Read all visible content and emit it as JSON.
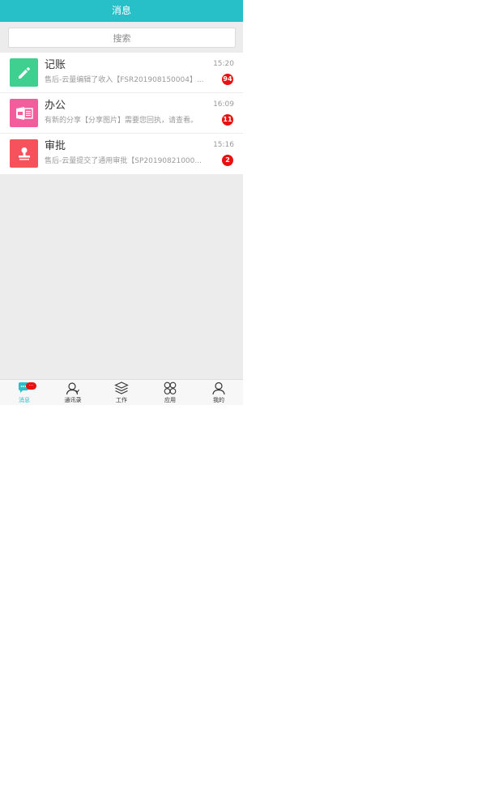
{
  "header": {
    "title": "消息"
  },
  "search": {
    "placeholder": "搜索"
  },
  "conversations": [
    {
      "title": "记账",
      "message": "售后-云量编辑了收入【FSR201908150004】...",
      "time": "15:20",
      "badge": "94",
      "icon": "pencil-icon",
      "color": "#3fcf8e"
    },
    {
      "title": "办公",
      "message": "有新的分享【分享图片】需要您回执，请查看。",
      "time": "16:09",
      "badge": "11",
      "icon": "office-icon",
      "color": "#f45d9b"
    },
    {
      "title": "审批",
      "message": "售后-云量提交了通用审批【SP20190821000...",
      "time": "15:16",
      "badge": "2",
      "icon": "stamp-icon",
      "color": "#f6525d"
    }
  ],
  "tabs": [
    {
      "label": "消息",
      "icon": "chat-icon",
      "active": true,
      "badge": "..."
    },
    {
      "label": "通讯录",
      "icon": "contacts-icon"
    },
    {
      "label": "工作",
      "icon": "layers-icon"
    },
    {
      "label": "应用",
      "icon": "apps-icon"
    },
    {
      "label": "我的",
      "icon": "user-icon"
    }
  ],
  "colors": {
    "accent": "#28c0c8",
    "badge": "#e8110f",
    "background": "#ececec"
  }
}
